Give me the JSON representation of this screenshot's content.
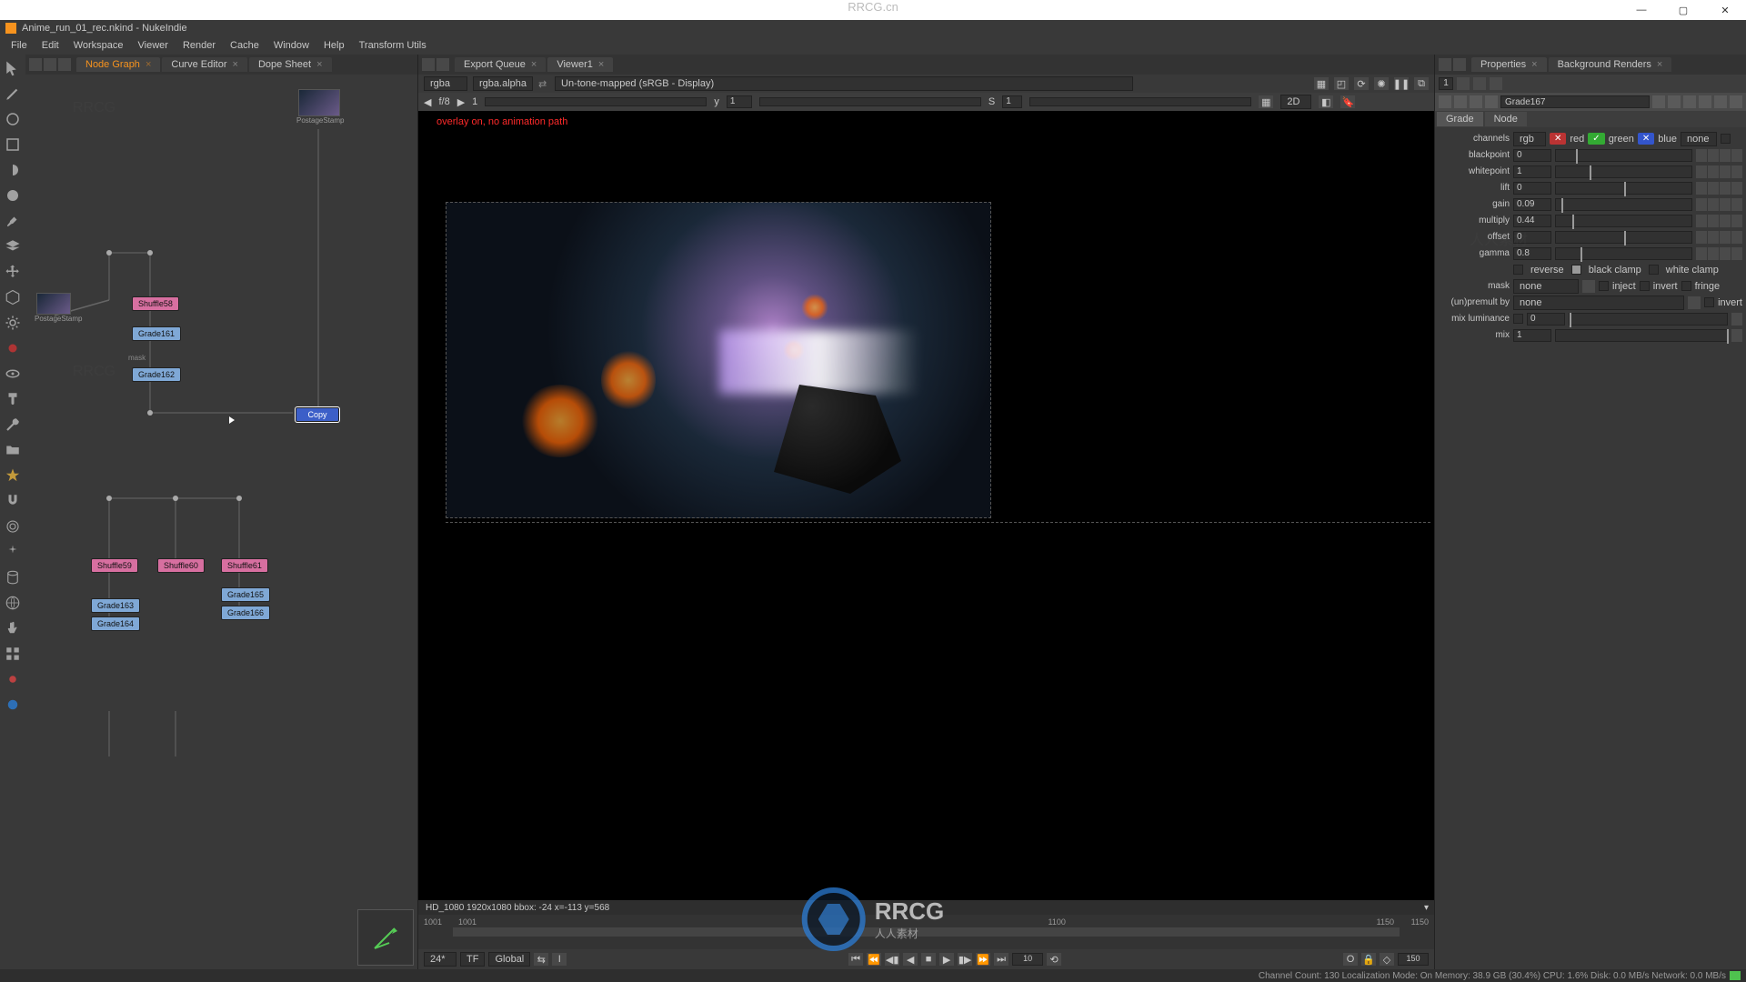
{
  "os_window": {
    "watermark_top": "RRCG.cn"
  },
  "app": {
    "title": "Anime_run_01_rec.nkind - NukeIndie"
  },
  "menus": [
    "File",
    "Edit",
    "Workspace",
    "Viewer",
    "Render",
    "Cache",
    "Window",
    "Help",
    "Transform Utils"
  ],
  "left_panel": {
    "tabs": [
      {
        "label": "Node Graph",
        "active": true
      },
      {
        "label": "Curve Editor",
        "active": false
      },
      {
        "label": "Dope Sheet",
        "active": false
      }
    ],
    "mask_label": "mask",
    "nodes": {
      "stamp1": "PostageStamp",
      "stamp2": "PostageStamp",
      "shuffle58": "Shuffle58",
      "grade161": "Grade161",
      "grade162": "Grade162",
      "selected": "Copy",
      "shuffle59": "Shuffle59",
      "shuffle60": "Shuffle60",
      "shuffle61": "Shuffle61",
      "grade163": "Grade163",
      "grade164": "Grade164",
      "grade165": "Grade165",
      "grade166": "Grade166"
    }
  },
  "viewer": {
    "tabs": [
      {
        "label": "Export Queue",
        "active": false
      },
      {
        "label": "Viewer1",
        "active": true
      }
    ],
    "channel_a": "rgba",
    "channel_b": "rgba.alpha",
    "colorspace": "Un-tone-mapped (sRGB - Display)",
    "frac": "f/8",
    "one": "1",
    "exp_y": "y",
    "exp_val": "1",
    "s_label": "S",
    "s_val": "1",
    "mode2d": "2D",
    "overlay_warning": "overlay on, no animation path",
    "info": "HD_1080 1920x1080  bbox: -24    x=-113 y=568",
    "timeline": {
      "start_label_outer": "1001",
      "start_label_inner": "1001",
      "mid_label": "1100",
      "end_label_inner": "1150",
      "end_label_outer": "1150"
    },
    "playback": {
      "fps": "24*",
      "tf": "TF",
      "global": "Global",
      "step": "10",
      "end": "150"
    }
  },
  "properties": {
    "tabs": [
      {
        "label": "Properties",
        "active": true
      },
      {
        "label": "Background Renders",
        "active": false
      }
    ],
    "panes_count": "1",
    "node_name": "Grade167",
    "subtabs": [
      "Grade",
      "Node"
    ],
    "channels": {
      "label": "channels",
      "value": "rgb",
      "red": "red",
      "green": "green",
      "blue": "blue",
      "none": "none"
    },
    "knobs": {
      "blackpoint": {
        "label": "blackpoint",
        "value": "0"
      },
      "whitepoint": {
        "label": "whitepoint",
        "value": "1"
      },
      "lift": {
        "label": "lift",
        "value": "0"
      },
      "gain": {
        "label": "gain",
        "value": "0.09"
      },
      "multiply": {
        "label": "multiply",
        "value": "0.44"
      },
      "offset": {
        "label": "offset",
        "value": "0"
      },
      "gamma": {
        "label": "gamma",
        "value": "0.8"
      }
    },
    "clamps": {
      "reverse": "reverse",
      "black": "black clamp",
      "white": "white clamp"
    },
    "mask": {
      "label": "mask",
      "value": "none",
      "inject": "inject",
      "invert": "invert",
      "fringe": "fringe"
    },
    "unpremult": {
      "label": "(un)premult by",
      "value": "none",
      "invert": "invert"
    },
    "mix_luminance": {
      "label": "mix luminance",
      "value": "0"
    },
    "mix": {
      "label": "mix",
      "value": "1"
    }
  },
  "statusbar": {
    "text": "Channel Count: 130 Localization Mode: On Memory: 38.9 GB (30.4%) CPU: 1.6% Disk: 0.0 MB/s Network: 0.0 MB/s"
  },
  "watermark": {
    "main": "RRCG",
    "sub": "人人素材"
  }
}
